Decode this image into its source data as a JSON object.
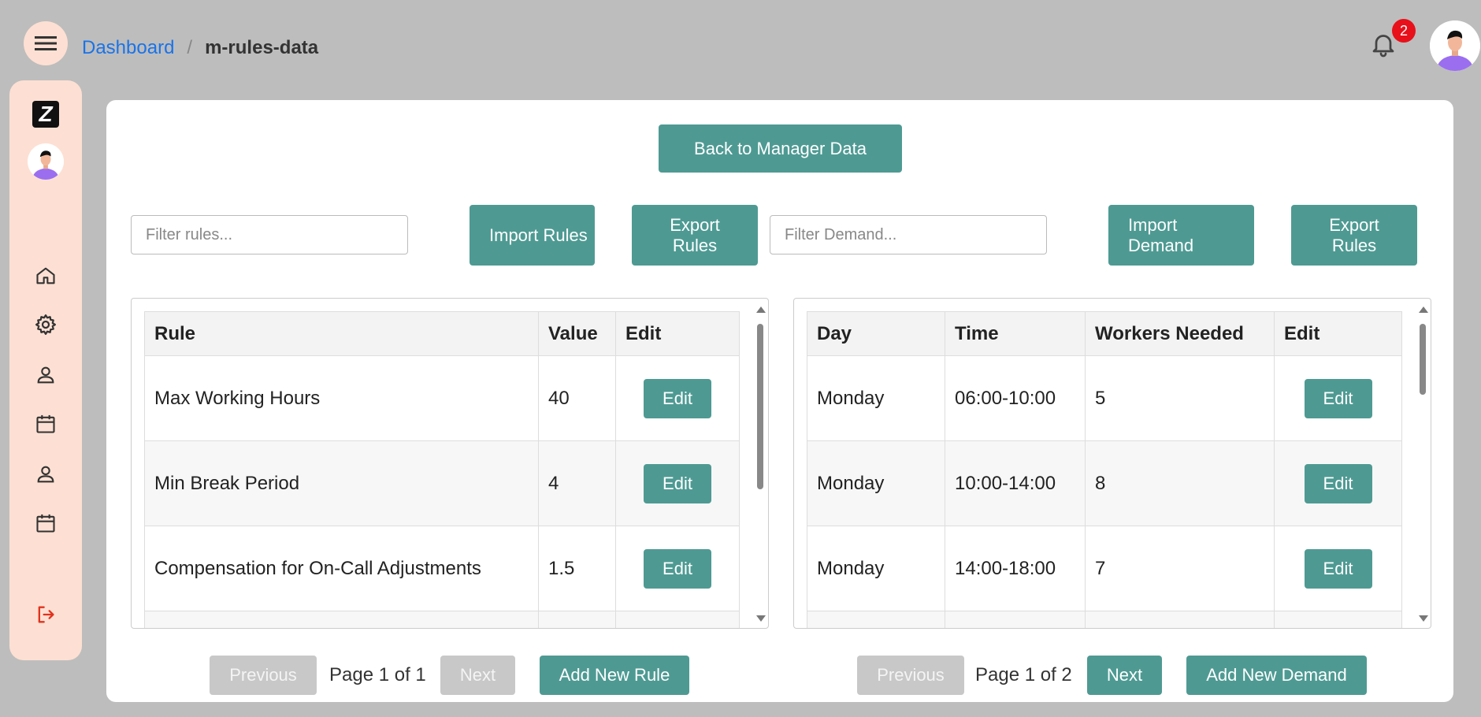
{
  "breadcrumb": {
    "home": "Dashboard",
    "separator": "/",
    "current": "m-rules-data"
  },
  "notifications": {
    "count": "2"
  },
  "sidebar": {
    "logo": "Z",
    "icons": [
      "home-icon",
      "gear-icon",
      "user-icon",
      "calendar-icon",
      "user-icon",
      "calendar-icon",
      "logout-icon"
    ]
  },
  "main": {
    "back_button": "Back to Manager Data",
    "rules": {
      "filter_placeholder": "Filter rules...",
      "import_label": "Import Rules",
      "export_label": "Export Rules",
      "columns": [
        "Rule",
        "Value",
        "Edit"
      ],
      "rows": [
        {
          "rule": "Max Working Hours",
          "value": "40",
          "edit": "Edit"
        },
        {
          "rule": "Min Break Period",
          "value": "4",
          "edit": "Edit"
        },
        {
          "rule": "Compensation for On-Call Adjustments",
          "value": "1.5",
          "edit": "Edit"
        }
      ],
      "prev_label": "Previous",
      "page_info": "Page 1 of 1",
      "next_label": "Next",
      "add_label": "Add New Rule"
    },
    "demand": {
      "filter_placeholder": "Filter Demand...",
      "import_label": "Import Demand",
      "export_label": "Export Rules",
      "columns": [
        "Day",
        "Time",
        "Workers Needed",
        "Edit"
      ],
      "rows": [
        {
          "day": "Monday",
          "time": "06:00-10:00",
          "workers": "5",
          "edit": "Edit"
        },
        {
          "day": "Monday",
          "time": "10:00-14:00",
          "workers": "8",
          "edit": "Edit"
        },
        {
          "day": "Monday",
          "time": "14:00-18:00",
          "workers": "7",
          "edit": "Edit"
        }
      ],
      "prev_label": "Previous",
      "page_info": "Page 1 of 2",
      "next_label": "Next",
      "add_label": "Add New Demand"
    }
  },
  "colors": {
    "accent": "#4e9a93",
    "sidebar_bg": "#fde0d3",
    "badge": "#e8101a",
    "link": "#1a73e8",
    "logout": "#e0321e"
  }
}
